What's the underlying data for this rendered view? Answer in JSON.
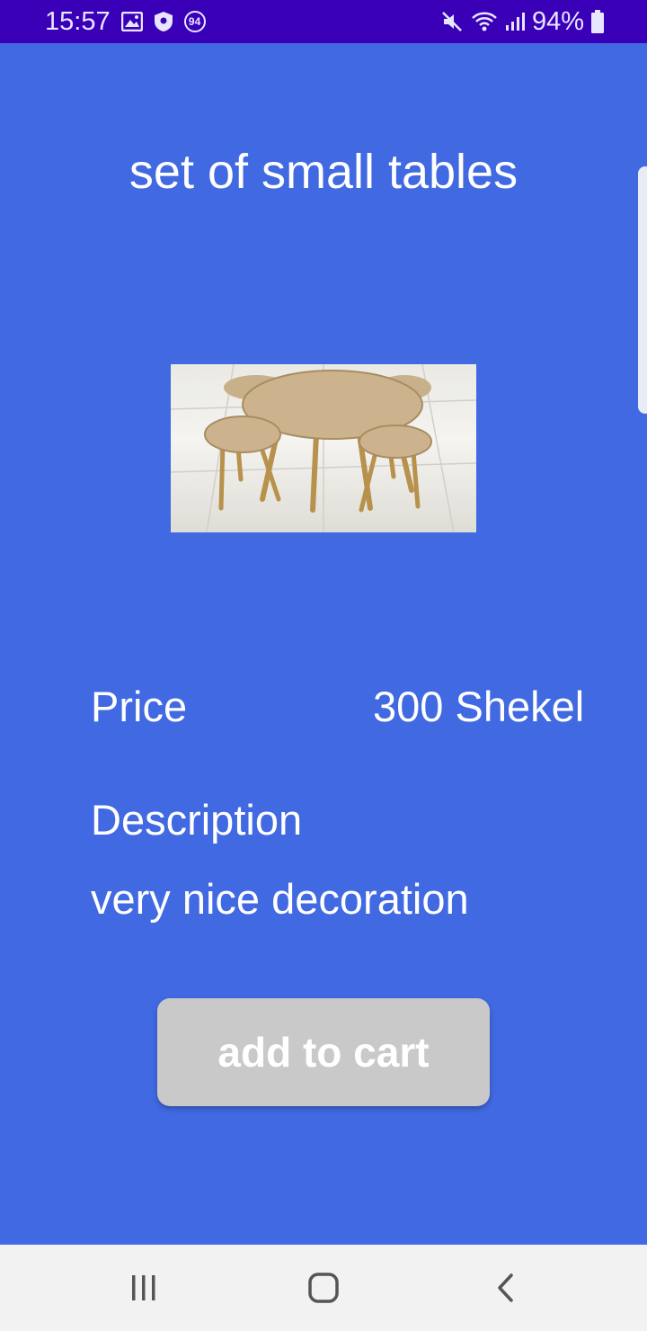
{
  "status_bar": {
    "time": "15:57",
    "badge_number": "94",
    "battery_percent": "94%",
    "icons_left": [
      "image-icon",
      "shield-icon",
      "badge-icon"
    ],
    "icons_right": [
      "mute-icon",
      "wifi-icon",
      "signal-icon",
      "battery-icon"
    ],
    "background": "#3a00b8"
  },
  "product": {
    "title": "set of small tables",
    "image_alt": "set of small tables photo",
    "price_label": "Price",
    "price_value": "300 Shekel",
    "description_label": "Description",
    "description_value": "very nice decoration"
  },
  "actions": {
    "add_to_cart_label": "add to cart"
  },
  "nav_bar": {
    "items": [
      "recent-apps-icon",
      "home-icon",
      "back-icon"
    ]
  },
  "colors": {
    "background": "#4169e1",
    "button": "#c9c9c9",
    "text": "#ffffff",
    "nav_bar": "#f2f2f2"
  }
}
